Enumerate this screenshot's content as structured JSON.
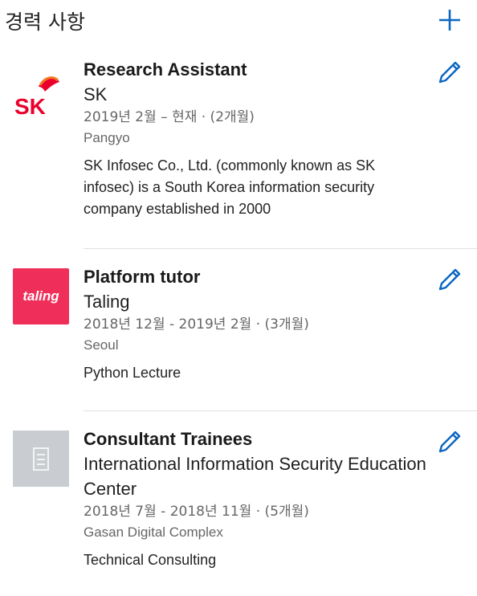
{
  "section": {
    "title": "경력 사항"
  },
  "colors": {
    "accent": "#0a66c2",
    "taling_brand": "#ef2f5a"
  },
  "experiences": [
    {
      "title": "Research Assistant",
      "company": "SK",
      "dates": "2019년 2월 – 현재 · (2개월)",
      "location": "Pangyo",
      "description": "SK Infosec Co., Ltd. (commonly known as SK infosec) is a South Korea information security company established in 2000",
      "logo": {
        "icon": "sk-logo",
        "text": "SK"
      }
    },
    {
      "title": "Platform tutor",
      "company": "Taling",
      "dates": "2018년 12월 - 2019년 2월 · (3개월)",
      "location": "Seoul",
      "description": "Python Lecture",
      "logo": {
        "icon": "taling-logo",
        "text": "taling"
      }
    },
    {
      "title": "Consultant Trainees",
      "company": "International Information Security Education Center",
      "dates": "2018년 7월 - 2018년 11월 · (5개월)",
      "location": "Gasan Digital Complex",
      "description": "Technical Consulting",
      "logo": {
        "icon": "building-icon"
      }
    }
  ]
}
